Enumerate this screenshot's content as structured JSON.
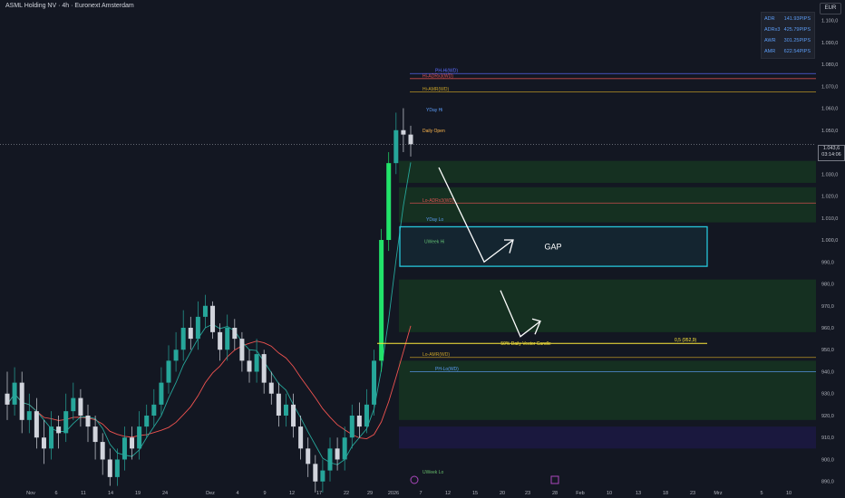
{
  "header": {
    "title": "ASML Holding NV · 4h · Euronext Amsterdam",
    "currency": "EUR"
  },
  "stats_panel": [
    {
      "label": "ADR",
      "value": "141.93PIPS"
    },
    {
      "label": "ADRx3",
      "value": "425.79PIPS"
    },
    {
      "label": "AWR",
      "value": "301.25PIPS"
    },
    {
      "label": "AMR",
      "value": "622.54PIPS"
    }
  ],
  "price_tag": {
    "price": "1.043,6",
    "countdown": "03:14:06"
  },
  "colors": {
    "background": "#131722",
    "up": "#26a69a",
    "down": "#d1d4dc",
    "strong_up": "#22e36a",
    "strong_down": "#2962ff",
    "gap_box": "#26c6da",
    "midline": "#ffeb3b"
  },
  "chart_data": {
    "type": "candlestick",
    "title": "ASML Holding NV · 4h · Euronext Amsterdam",
    "y_ticks": [
      "1.100,0",
      "1.090,0",
      "1.080,0",
      "1.070,0",
      "1.060,0",
      "1.050,0",
      "1.040,0",
      "1.030,0",
      "1.020,0",
      "1.010,0",
      "1.000,0",
      "990,0",
      "980,0",
      "970,0",
      "960,0",
      "950,0",
      "940,0",
      "930,0",
      "920,0",
      "910,0",
      "900,0",
      "890,0"
    ],
    "ylim": [
      887,
      1106
    ],
    "x_ticks": [
      "Nov",
      "6",
      "11",
      "14",
      "19",
      "24",
      "Dez",
      "4",
      "9",
      "12",
      "17",
      "22",
      "29",
      "2026",
      "7",
      "12",
      "15",
      "20",
      "23",
      "28",
      "Feb",
      "10",
      "13",
      "18",
      "23",
      "Mrz",
      "5",
      "10"
    ],
    "price_levels": [
      {
        "label": "PH-Hi(WD)",
        "price": 1075.8,
        "color": "#5b6cff"
      },
      {
        "label": "Hi-ADRx3(WD)",
        "price": 1073.5,
        "color": "#e05252"
      },
      {
        "label": "Hi-AMR(WD)",
        "price": 1067.5,
        "color": "#c9a227"
      },
      {
        "label": "YDay Hi",
        "price": 1058.0,
        "color": "#5b9cf6"
      },
      {
        "label": "Daily Open",
        "price": 1048.5,
        "color": "#ffb74d"
      },
      {
        "label": "Lo-ADRx3(WD)",
        "price": 1016.8,
        "color": "#e05252"
      },
      {
        "label": "YDay Lo",
        "price": 1008.0,
        "color": "#5b9cf6"
      },
      {
        "label": "UWeek Hi",
        "price": 998.0,
        "color": "#66bb6a"
      },
      {
        "label": "Lo-AMR(WD)",
        "price": 946.5,
        "color": "#c9a227"
      },
      {
        "label": "PH-Lo(WD)",
        "price": 940.0,
        "color": "#5b9cf6"
      },
      {
        "label": "UWeek Lo",
        "price": 893.0,
        "color": "#66bb6a"
      }
    ],
    "annotations": {
      "gap_label": "GAP",
      "midline_label": "50% Daily Vector Candle",
      "midline_value": "0,5 (952,9)",
      "midline_price": 952.9
    },
    "last_price": 1043.6,
    "candles": {
      "open": [
        930,
        925,
        935,
        918,
        922,
        910,
        905,
        915,
        912,
        922,
        928,
        920,
        915,
        908,
        900,
        892,
        900,
        910,
        905,
        915,
        920,
        925,
        935,
        945,
        950,
        960,
        955,
        965,
        970,
        958,
        950,
        960,
        955,
        945,
        940,
        948,
        935,
        930,
        920,
        925,
        915,
        905,
        898,
        890,
        895,
        905,
        900,
        910,
        920,
        915,
        925,
        945,
        1000,
        1035,
        1050,
        1048
      ],
      "close": [
        925,
        935,
        918,
        922,
        910,
        905,
        915,
        912,
        922,
        928,
        920,
        915,
        908,
        900,
        892,
        900,
        910,
        905,
        915,
        920,
        925,
        935,
        945,
        950,
        960,
        955,
        965,
        970,
        958,
        950,
        960,
        955,
        945,
        940,
        948,
        935,
        930,
        920,
        925,
        915,
        905,
        898,
        890,
        895,
        905,
        900,
        910,
        920,
        915,
        925,
        945,
        1000,
        1035,
        1050,
        1048,
        1043.6
      ],
      "high": [
        940,
        942,
        940,
        930,
        928,
        918,
        922,
        920,
        930,
        935,
        932,
        925,
        920,
        912,
        905,
        905,
        915,
        915,
        922,
        925,
        932,
        942,
        952,
        958,
        968,
        965,
        972,
        975,
        972,
        962,
        966,
        964,
        958,
        950,
        955,
        950,
        940,
        935,
        930,
        930,
        920,
        910,
        902,
        900,
        910,
        910,
        915,
        925,
        926,
        932,
        950,
        1005,
        1040,
        1058,
        1060,
        1052
      ],
      "low": [
        918,
        920,
        912,
        912,
        905,
        898,
        900,
        905,
        908,
        918,
        915,
        908,
        900,
        893,
        888,
        888,
        895,
        900,
        900,
        910,
        915,
        920,
        930,
        940,
        945,
        950,
        950,
        960,
        955,
        945,
        945,
        950,
        940,
        935,
        935,
        930,
        925,
        915,
        915,
        910,
        900,
        892,
        885,
        885,
        890,
        895,
        895,
        905,
        910,
        912,
        920,
        940,
        995,
        1030,
        1040,
        1038
      ]
    }
  }
}
